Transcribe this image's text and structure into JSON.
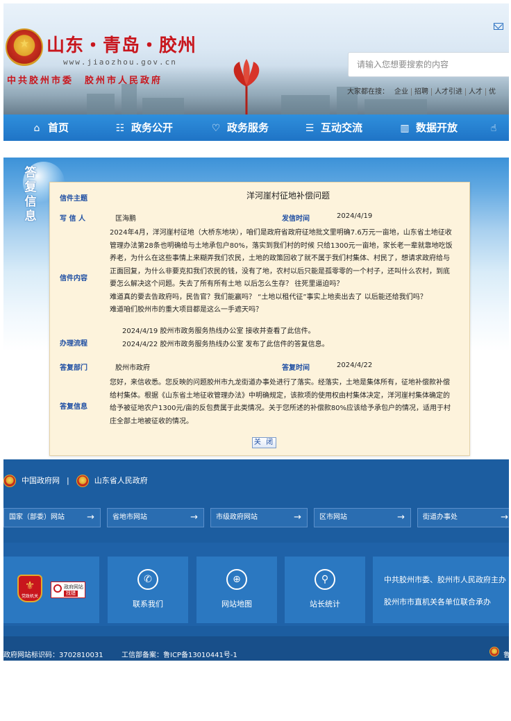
{
  "header": {
    "site_title": "山东・青岛・胶州",
    "site_url": "www.jiaozhou.gov.cn",
    "org_line": "中共胶州市委　胶州市人民政府",
    "search_placeholder": "请输入您想要搜索的内容",
    "hot_search_label": "大家都在搜：",
    "hot_search_tags": [
      "企业",
      "招聘",
      "人才引进",
      "人才",
      "优"
    ]
  },
  "nav": {
    "items": [
      {
        "label": "首页",
        "icon": "home-icon"
      },
      {
        "label": "政务公开",
        "icon": "doc-icon"
      },
      {
        "label": "政务服务",
        "icon": "heart-icon"
      },
      {
        "label": "互动交流",
        "icon": "chat-icon"
      },
      {
        "label": "数据开放",
        "icon": "bar-chart-icon"
      },
      {
        "label": "",
        "icon": "hand-icon"
      }
    ]
  },
  "letter": {
    "section_label": "答复信息",
    "subject_label": "信件主题",
    "subject": "洋河崖村征地补偿问题",
    "writer_label": "写 信 人",
    "writer": "匡海鹏",
    "send_time_label": "发信时间",
    "send_time": "2024/4/19",
    "content_label": "信件内容",
    "content_lines": [
      "2024年4月，洋河崖村征地（大桥东地块），咱们是政府省政府征地批文里明确7.6万元一亩地，山东省土地征收",
      "管理办法第28条也明确给与土地承包户80%，落实到我们村的时候 只给1300元一亩地，家长老一辈就靠地吃饭",
      "养老，为什么在这些事情上来糊弄我们农民，土地的政策回收了就不属于我们村集体、村民了，想请求政府给与",
      "正面回复，为什么非要克扣我们农民的钱，没有了地，农村以后只能是孤零零的一个村子，还叫什么农村，到底",
      "要怎么解决这个问题。失去了所有所有土地 以后怎么生存？ 往死里逼迫吗？",
      "难道真的要去告政府吗，民告官？我们能赢吗？ “土地以租代征”事实上地卖出去了 以后能还给我们吗？",
      "难道咱们胶州市的重大项目都是这么一手遮天吗？"
    ],
    "process_label": "办理流程",
    "process_lines": [
      "2024/4/19  胶州市政务服务热线办公室  接收并查看了此信件。",
      "2024/4/22  胶州市政务服务热线办公室  发布了此信件的答复信息。"
    ],
    "dept_label": "答复部门",
    "dept": "胶州市政府",
    "reply_time_label": "答复时间",
    "reply_time": "2024/4/22",
    "reply_label": "答复信息",
    "reply_lines": [
      "您好，来信收悉。您反映的问题胶州市九龙街道办事处进行了落实。经落实，土地是集体所有，征地补偿款补偿",
      "给村集体。根据《山东省土地征收管理办法》中明确规定，该款项的使用权由村集体决定，洋河崖村集体确定的",
      "给予被征地农户1300元/亩的反包费属于此类情况。关于您所述的补偿款80%应该给予承包户的情况，适用于村",
      "庄全部土地被征收的情况。"
    ],
    "close_label": "关 闭"
  },
  "footer": {
    "gov_link_1": "中国政府网",
    "divider": "|",
    "gov_link_2": "山东省人民政府",
    "selects": [
      "国家（部委）网站",
      "省地市网站",
      "市级政府网站",
      "区市网站",
      "街道办事处"
    ],
    "party_badge_label": "党政机关",
    "error_badge_line1": "政府网站",
    "error_badge_line2": "找错",
    "cards": [
      {
        "label": "联系我们",
        "icon": "phone-icon",
        "glyph": "✆"
      },
      {
        "label": "网站地图",
        "icon": "globe-icon",
        "glyph": "⊕"
      },
      {
        "label": "站长统计",
        "icon": "stats-board-icon",
        "glyph": "⚲"
      }
    ],
    "sponsor_1": "中共胶州市委、胶州市人民政府主办",
    "sponsor_2": "胶州市市直机关各单位联合承办",
    "site_code": "政府网站标识码：3702810031",
    "icp": "工信部备案：鲁ICP备13010441号-1",
    "tail": "鲁"
  }
}
